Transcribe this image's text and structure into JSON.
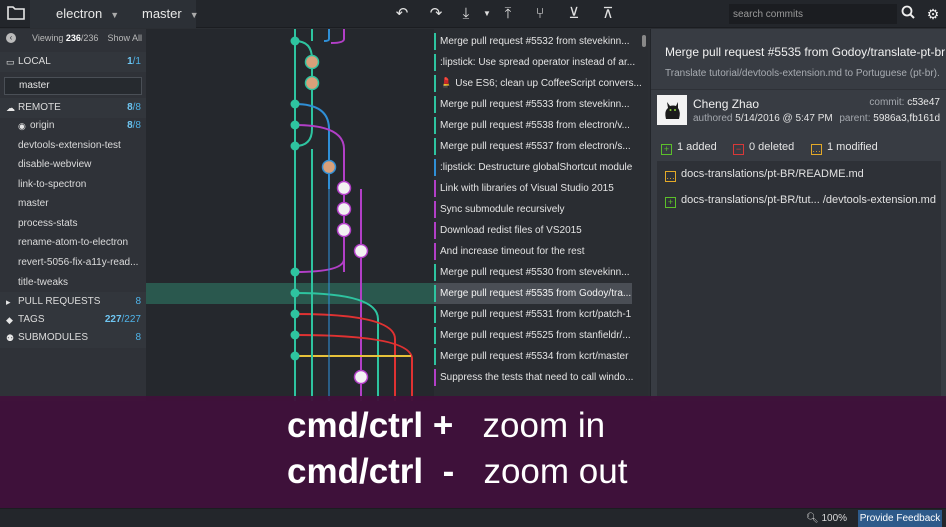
{
  "toolbar": {
    "repo": "electron",
    "branch": "master",
    "search_placeholder": "search commits",
    "icons": [
      "folder-icon",
      "undo-icon",
      "redo-icon",
      "pull-icon",
      "push-icon",
      "branch-icon",
      "stash-icon",
      "pop-icon",
      "search-icon",
      "gear-icon"
    ]
  },
  "sidebar": {
    "viewing_prefix": "Viewing",
    "viewing_count": "236",
    "viewing_total": "/236",
    "show_all": "Show All",
    "local": {
      "label": "LOCAL",
      "count": "1",
      "total": "/1"
    },
    "filter_value": "master",
    "remote": {
      "label": "REMOTE",
      "count": "8",
      "total": "/8"
    },
    "origin": {
      "label": "origin",
      "count": "8",
      "total": "/8"
    },
    "branches": [
      "devtools-extension-test",
      "disable-webview",
      "link-to-spectron",
      "master",
      "process-stats",
      "rename-atom-to-electron",
      "revert-5056-fix-a11y-read...",
      "title-tweaks"
    ],
    "pull_requests": {
      "label": "PULL REQUESTS",
      "count": "8"
    },
    "tags": {
      "label": "TAGS",
      "count": "227",
      "total": "/227"
    },
    "submodules": {
      "label": "SUBMODULES",
      "count": "8"
    }
  },
  "commits": [
    {
      "msg": "Merge pull request #5532 from stevekinn...",
      "color": "#2ec4a0"
    },
    {
      "msg": ":lipstick: Use spread operator instead of ar...",
      "color": "#2ec4a0"
    },
    {
      "msg": "💄 Use ES6; clean up CoffeeScript convers...",
      "color": "#2ec4a0"
    },
    {
      "msg": "Merge pull request #5533 from stevekinn...",
      "color": "#2ec4a0"
    },
    {
      "msg": "Merge pull request #5538 from electron/v...",
      "color": "#2ec4a0"
    },
    {
      "msg": "Merge pull request #5537 from electron/s...",
      "color": "#2ec4a0"
    },
    {
      "msg": ":lipstick: Destructure globalShortcut module",
      "color": "#2f8fd6"
    },
    {
      "msg": "Link with libraries of Visual Studio 2015",
      "color": "#b23fc7"
    },
    {
      "msg": "Sync submodule recursively",
      "color": "#b23fc7"
    },
    {
      "msg": "Download redist files of VS2015",
      "color": "#b23fc7"
    },
    {
      "msg": "And increase timeout for the rest",
      "color": "#b23fc7"
    },
    {
      "msg": "Merge pull request #5530 from stevekinn...",
      "color": "#2ec4a0"
    },
    {
      "msg": "Merge pull request #5535 from Godoy/tra...",
      "color": "#2ec4a0"
    },
    {
      "msg": "Merge pull request #5531 from kcrt/patch-1",
      "color": "#2ec4a0"
    },
    {
      "msg": "Merge pull request #5525 from stanfieldr/...",
      "color": "#2ec4a0"
    },
    {
      "msg": "Merge pull request #5534 from kcrt/master",
      "color": "#2ec4a0"
    },
    {
      "msg": "Suppress the tests that need to call windo...",
      "color": "#b23fc7"
    }
  ],
  "detail": {
    "title": "Merge pull request #5535 from Godoy/translate-pt-br",
    "description": "Translate tutorial/devtools-extension.md to Portuguese (pt-br).",
    "author": "Cheng Zhao",
    "authored_label": "authored",
    "authored_date": "5/14/2016 @ 5:47 PM",
    "commit_label": "commit:",
    "commit_sha": "c53e47",
    "parent_label": "parent:",
    "parent_sha": "5986a3,fb161d",
    "added": "1 added",
    "deleted": "0 deleted",
    "modified": "1 modified",
    "files": [
      {
        "status": "modified",
        "name": "docs-translations/pt-BR/README.md"
      },
      {
        "status": "added",
        "name": "docs-translations/pt-BR/tut... /devtools-extension.md"
      }
    ]
  },
  "banner": {
    "line1_key": "cmd/ctrl",
    "line1_op": "+",
    "line1_action": "zoom in",
    "line2_key": "cmd/ctrl",
    "line2_op": "-",
    "line2_action": "zoom out"
  },
  "status": {
    "zoom": "100%",
    "feedback": "Provide Feedback"
  },
  "colors": {
    "teal": "#2ec4a0",
    "purple": "#b23fc7",
    "blue": "#2f8fd6",
    "red": "#e03232",
    "yellow": "#e7c23a",
    "banner": "#40113a"
  }
}
